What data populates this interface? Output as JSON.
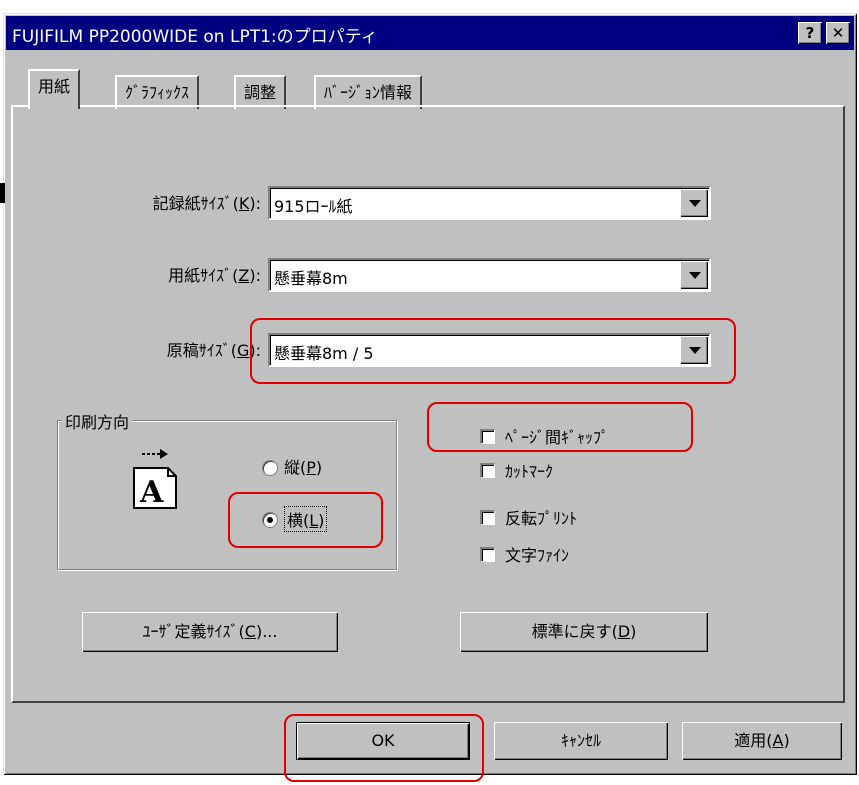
{
  "window": {
    "title": "FUJIFILM PP2000WIDE on LPT1:のプロパティ",
    "help_label": "?",
    "close_label": "✕"
  },
  "tabs": [
    "用紙",
    "ｸﾞﾗﾌｨｯｸｽ",
    "調整",
    "ﾊﾞｰｼﾞｮﾝ情報"
  ],
  "fields": {
    "recording": {
      "label_pre": "記録紙ｻｲｽﾞ(",
      "label_key": "K",
      "label_post": "):",
      "value": "915ロｰﾙ紙"
    },
    "paper": {
      "label_pre": "用紙ｻｲｽﾞ(",
      "label_key": "Z",
      "label_post": "):",
      "value": "懸垂幕8m"
    },
    "original": {
      "label_pre": "原稿ｻｲｽﾞ(",
      "label_key": "G",
      "label_post": "):",
      "value": "懸垂幕8m / 5"
    }
  },
  "orientation": {
    "title": "印刷方向",
    "portrait": {
      "pre": "縦(",
      "key": "P",
      "post": ")"
    },
    "landscape": {
      "pre": "横(",
      "key": "L",
      "post": ")"
    },
    "selected": "landscape",
    "icon_letter": "A"
  },
  "options": [
    {
      "label": "ﾍﾟｰｼﾞ間ｷﾞｬｯﾌﾟ",
      "checked": false
    },
    {
      "label": "ｶｯﾄﾏｰｸ",
      "checked": false
    },
    {
      "label": "反転ﾌﾟﾘﾝﾄ",
      "checked": false
    },
    {
      "label": "文字ﾌｧｲﾝ",
      "checked": false
    }
  ],
  "buttons": {
    "user_size": {
      "pre": "ﾕｰｻﾞ定義ｻｲｽﾞ(",
      "key": "C",
      "post": ")..."
    },
    "reset": {
      "pre": "標準に戻す(",
      "key": "D",
      "post": ")"
    },
    "ok": "OK",
    "cancel": "ｷｬﾝｾﾙ",
    "apply": {
      "pre": "適用(",
      "key": "A",
      "post": ")"
    }
  },
  "colors": {
    "titlebar": "#000080",
    "face": "#c0c0c0",
    "highlight_annotation": "#e00000"
  }
}
